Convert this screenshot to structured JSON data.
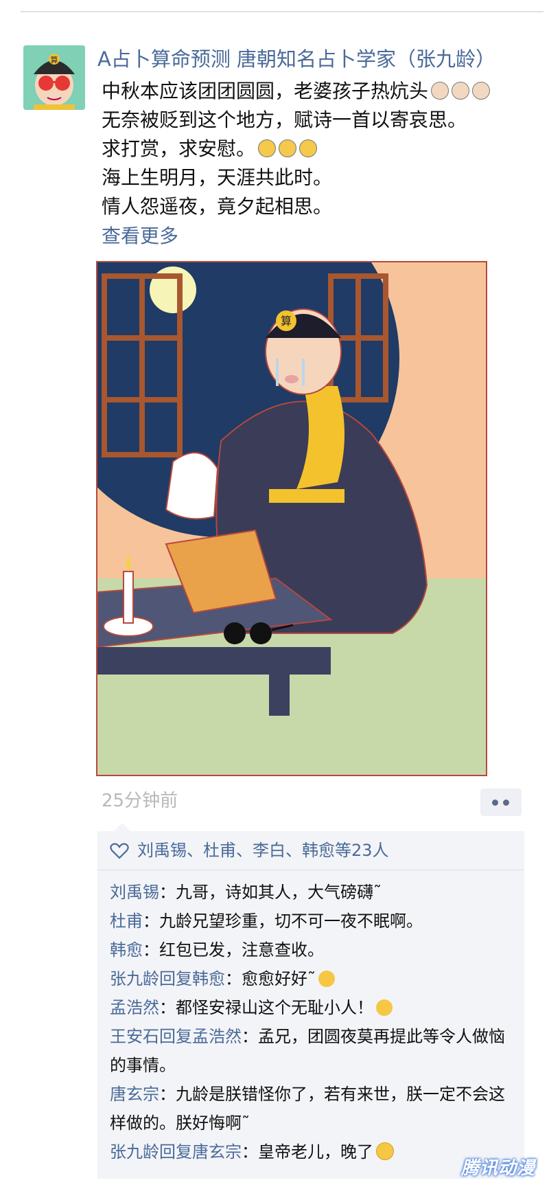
{
  "post": {
    "author": "A占卜算命预测 唐朝知名占卜学家（张九龄）",
    "lines": [
      "中秋本应该团团圆圆，老婆孩子热炕头",
      "无奈被贬到这个地方，赋诗一首以寄哀思。",
      "求打赏，求安慰。",
      "海上生明月，天涯共此时。",
      "情人怨遥夜，竟夕起相思。"
    ],
    "see_more": "查看更多",
    "avatar_badge": "算",
    "comic_hat_badge": "算",
    "time": "25分钟前"
  },
  "likes": {
    "text": "刘禹锡、杜甫、李白、韩愈等23人"
  },
  "comments": [
    {
      "author": "刘禹锡",
      "sep": "：",
      "text": "九哥，诗如其人，大气磅礴˜"
    },
    {
      "author": "杜甫",
      "sep": "：",
      "text": "九龄兄望珍重，切不可一夜不眠啊。"
    },
    {
      "author": "韩愈",
      "sep": "：",
      "text": "红包已发，注意查收。"
    },
    {
      "author": "张九龄",
      "reply_word": "回复",
      "reply_to": "韩愈",
      "sep": "：",
      "text": "愈愈好好˜",
      "emoji": "kiss-emoji"
    },
    {
      "author": "孟浩然",
      "sep": "：",
      "text": "都怪安禄山这个无耻小人！",
      "emoji": "angry-emoji"
    },
    {
      "author": "王安石",
      "reply_word": "回复",
      "reply_to": "孟浩然",
      "sep": "：",
      "text": "孟兄，团圆夜莫再提此等令人做恼的事情。"
    },
    {
      "author": "唐玄宗",
      "sep": "：",
      "text": "九龄是朕错怪你了，若有来世，朕一定不会这样做的。朕好悔啊˜"
    },
    {
      "author": "张九龄",
      "reply_word": "回复",
      "reply_to": "唐玄宗",
      "sep": "：",
      "text": "皇帝老儿，晚了",
      "emoji": "smile-emoji"
    }
  ],
  "watermark": "腾讯动漫",
  "colors": {
    "link_blue": "#4a6a99",
    "comic_border": "#b6483d",
    "comments_bg": "#f3f4f7"
  }
}
